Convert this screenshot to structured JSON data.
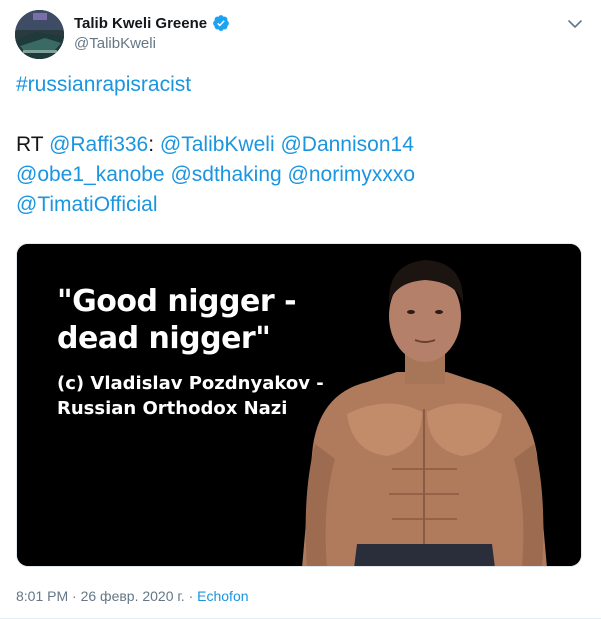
{
  "author": {
    "display_name": "Talib Kweli Greene",
    "handle": "@TalibKweli",
    "verified_icon": "verified-badge-icon",
    "avatar": "profile-avatar"
  },
  "tweet": {
    "hashtag": "#russianrapisracist",
    "rt_prefix": "RT ",
    "rt_source": "@Raffi336",
    "rt_colon": ":",
    "mentions": [
      "@TalibKweli",
      "@Dannison14",
      "@obe1_kanobe",
      "@sdthaking",
      "@norimyxxxo",
      "@TimatiOfficial"
    ]
  },
  "media": {
    "quote_line1": "\"Good nigger -",
    "quote_line2": "dead nigger\"",
    "caption_line1": "(c) Vladislav Pozdnyakov -",
    "caption_line2": "Russian Orthodox Nazi"
  },
  "meta": {
    "time": "8:01 PM",
    "separator": "·",
    "date": "26 февр. 2020 г.",
    "source": "Echofon"
  },
  "colors": {
    "link": "#1b95e0",
    "secondary_text": "#657786",
    "primary_text": "#14171a"
  }
}
